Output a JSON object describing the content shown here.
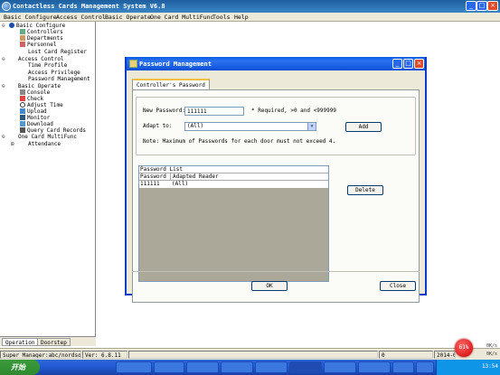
{
  "window": {
    "title": "Contactless Cards Management System  V6.8"
  },
  "menu": [
    "Basic Configure",
    "Access Control",
    "Basic Operate",
    "One Card MultiFunc",
    "Tools",
    "Help"
  ],
  "tree": {
    "groups": [
      {
        "label": "Basic Configure",
        "items": [
          "Controllers",
          "Departments",
          "Personnel",
          "Lost Card Register"
        ]
      },
      {
        "label": "Access Control",
        "items": [
          "Time Profile",
          "Access Privilege",
          "Password Management"
        ]
      },
      {
        "label": "Basic Operate",
        "items": [
          "Console",
          "Check",
          "Adjust Time",
          "Upload",
          "Monitor",
          "Download",
          "Query Card Records"
        ]
      },
      {
        "label": "One Card MultiFunc",
        "items": [
          "Attendance"
        ]
      }
    ],
    "tabs": [
      "Operation",
      "Doorstep"
    ]
  },
  "dialog": {
    "title": "Password Management",
    "tab": "Controller's Password",
    "new_password_label": "New Password:",
    "new_password_value": "111111",
    "required_text": "* Required,  >0 and <999999",
    "adapt_label": "Adapt to:",
    "adapt_value": "(All)",
    "add_button": "Add",
    "note": "Note:  Maximum of Passwords for each door must not exceed 4.",
    "list_title": "Password List",
    "columns": [
      "Password",
      "Adapted Reader"
    ],
    "rows": [
      [
        "111111",
        "(All)"
      ]
    ],
    "delete_button": "Delete",
    "ok_button": "OK",
    "close_button": "Close"
  },
  "status": {
    "user": "Super Manager:abc/nordson",
    "version": "Ver: 6.8.11",
    "count": "0"
  },
  "taskbar": {
    "start": "开始",
    "tasks": [
      "",
      "",
      "",
      "",
      "",
      "",
      "",
      "",
      "",
      ""
    ],
    "clock": "13:54",
    "date": "2014-0",
    "net": "61%",
    "rate_up": "0K/s",
    "rate_down": "0K/s"
  }
}
